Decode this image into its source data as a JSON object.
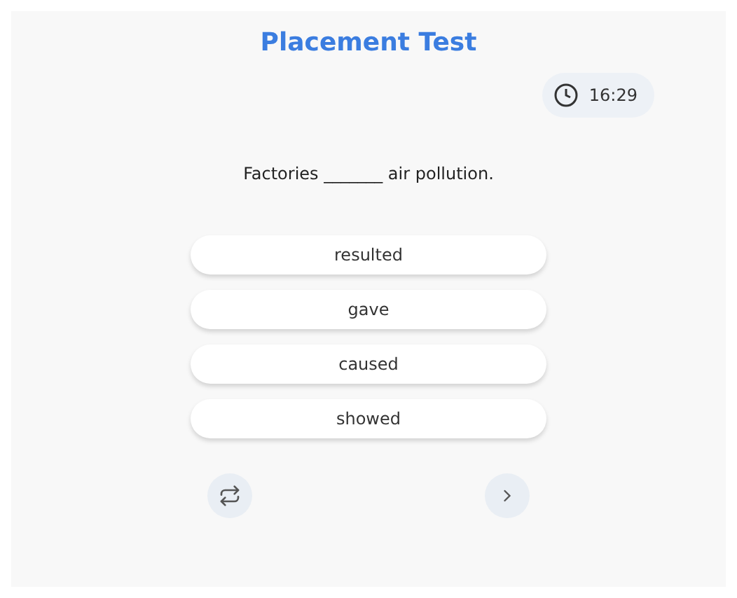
{
  "title": "Placement Test",
  "timer": {
    "time": "16:29"
  },
  "question": "Factories _______ air pollution.",
  "options": [
    {
      "label": "resulted"
    },
    {
      "label": "gave"
    },
    {
      "label": "caused"
    },
    {
      "label": "showed"
    }
  ]
}
